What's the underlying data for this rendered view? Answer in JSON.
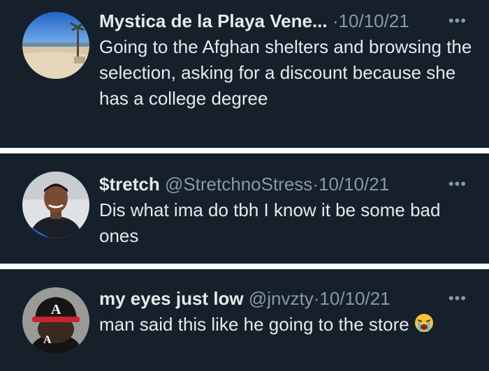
{
  "tweets": [
    {
      "name": "Mystica de la Playa Vene...",
      "handle": "",
      "separator": "·",
      "date": "10/10/21",
      "more_icon": "more-dots-icon",
      "text": "Going to the Afghan shelters and browsing the selection, asking for a discount because she has a college degree"
    },
    {
      "name": "$tretch",
      "handle": "@StretchnoStress",
      "separator": "·",
      "date": "10/10/21",
      "more_icon": "more-dots-icon",
      "text": "Dis what ima do tbh I know it be some bad ones"
    },
    {
      "name": "my eyes just low",
      "handle": "@jnvzty",
      "separator": "·",
      "date": "10/10/21",
      "more_icon": "more-dots-icon",
      "text": "man said this like he going to the store",
      "emoji": "loudly-crying-face-emoji"
    }
  ],
  "colors": {
    "background": "#15202b",
    "divider": "#ffffff",
    "primary_text": "#e7e9ea",
    "secondary_text": "#8b98a5"
  }
}
